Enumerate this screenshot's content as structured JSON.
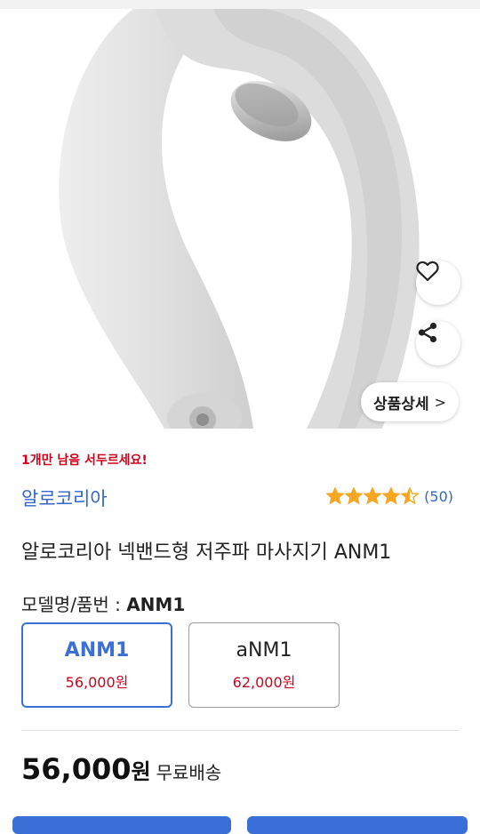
{
  "product_image": {
    "alt": "neckband massager",
    "detail_button_label": "상품상세",
    "detail_button_arrow": ">",
    "icons": [
      "heart-icon",
      "share-icon",
      "chevron-right-icon"
    ]
  },
  "stock_notice": "1개만 남음 서두르세요!",
  "brand": "알로코리아",
  "rating": {
    "stars": 4.5,
    "max": 5,
    "count_label": "(50)",
    "star_color": "#f5a623"
  },
  "product_title": "알로코리아 넥밴드형 저주파 마사지기 ANM1",
  "model": {
    "label": "모델명/품번 : ",
    "value": "ANM1"
  },
  "options": [
    {
      "name": "ANM1",
      "price": "56,000원",
      "selected": true
    },
    {
      "name": "aNM1",
      "price": "62,000원",
      "selected": false
    }
  ],
  "price": {
    "amount": "56,000",
    "currency": "원",
    "shipping": "무료배송"
  },
  "colors": {
    "accent": "#3b6fd8",
    "link": "#3366cc",
    "alert": "#d0021b"
  }
}
